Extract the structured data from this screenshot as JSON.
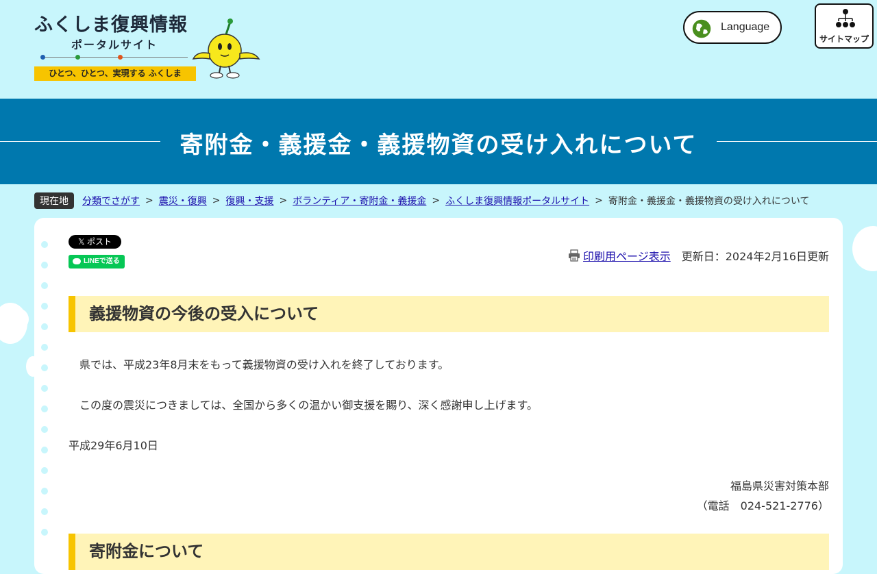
{
  "header": {
    "logo_title": "ふくしま復興情報",
    "logo_subtitle": "ポータルサイト",
    "logo_tagline": "ひとつ、ひとつ、実現する ふくしま",
    "language_label": "Language",
    "sitemap_label": "サイトマップ"
  },
  "banner": {
    "title": "寄附金・義援金・義援物資の受け入れについて"
  },
  "breadcrumb": {
    "here_label": "現在地",
    "links": [
      "分類でさがす",
      "震災・復興",
      "復興・支援",
      "ボランティア・寄附金・義援金",
      "ふくしま復興情報ポータルサイト"
    ],
    "separator": ">",
    "current": "寄附金・義援金・義援物資の受け入れについて"
  },
  "share": {
    "x_label": "𝕏 ポスト",
    "line_label": "LINEで送る"
  },
  "meta": {
    "print_label": "印刷用ページ表示",
    "updated": "更新日：2024年2月16日更新"
  },
  "section1": {
    "heading": "義援物資の今後の受入について",
    "para1": "県では、平成23年8月末をもって義援物資の受け入れを終了しております。",
    "para2": "この度の震災につきましては、全国から多くの温かい御支援を賜り、深く感謝申し上げます。",
    "date": "平成29年6月10日",
    "signature_org": "福島県災害対策本部",
    "signature_tel": "（電話　024-521-2776）"
  },
  "section2": {
    "heading": "寄附金について"
  }
}
